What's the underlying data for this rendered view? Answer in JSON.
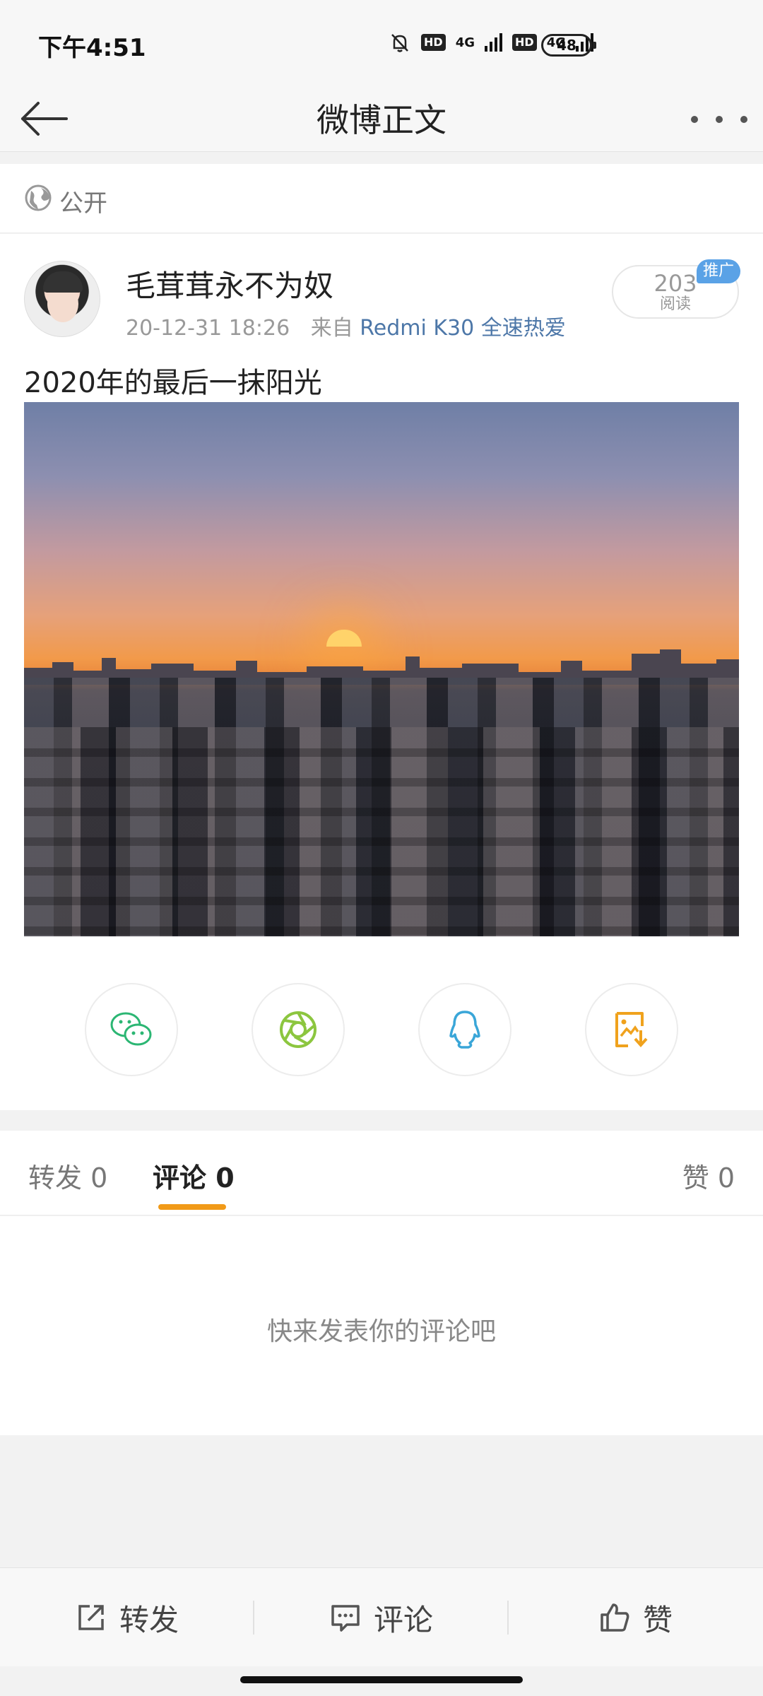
{
  "status_bar": {
    "time": "下午4:51",
    "hd": "HD",
    "network": "4G",
    "battery": "48"
  },
  "header": {
    "title": "微博正文",
    "back_icon": "arrow-left-icon",
    "more_icon": "more-dots-icon"
  },
  "visibility": {
    "icon": "globe-icon",
    "label": "公开"
  },
  "post": {
    "author": "毛茸茸永不为奴",
    "date": "20-12-31 18:26",
    "source_label": "来自",
    "source_device": "Redmi K30 全速热爱",
    "read_count": "203",
    "read_label": "阅读",
    "promo_badge": "推广",
    "text": "2020年的最后一抹阳光",
    "image": "sunset-city-photo"
  },
  "share_targets": [
    {
      "icon": "wechat-icon",
      "color": "#2bb673"
    },
    {
      "icon": "moments-icon",
      "color": "#8cc63f"
    },
    {
      "icon": "qq-icon",
      "color": "#3aa6d8"
    },
    {
      "icon": "save-image-icon",
      "color": "#f0a21d"
    }
  ],
  "tabs": {
    "repost": "转发 0",
    "comment": "评论 0",
    "like": "赞 0",
    "accent": "#f19a18"
  },
  "comments": {
    "empty_text": "快来发表你的评论吧"
  },
  "bottom_bar": {
    "repost": "转发",
    "comment": "评论",
    "like": "赞"
  }
}
